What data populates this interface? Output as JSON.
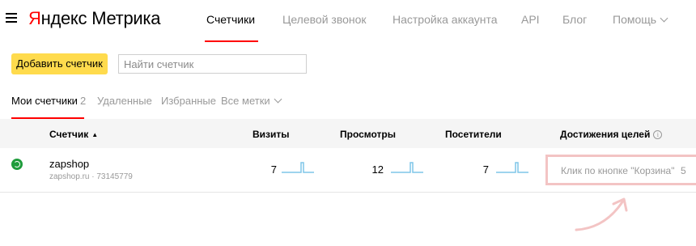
{
  "header": {
    "logo": {
      "ya": "Я",
      "rest": "ндекс",
      "product": "Метрика"
    },
    "nav": [
      {
        "label": "Счетчики",
        "active": true
      },
      {
        "label": "Целевой звонок"
      },
      {
        "label": "Настройка аккаунта"
      },
      {
        "label": "API"
      },
      {
        "label": "Блог"
      },
      {
        "label": "Помощь"
      }
    ]
  },
  "toolbar": {
    "add_button": "Добавить счетчик",
    "search_placeholder": "Найти счетчик"
  },
  "tabs": {
    "mine": "Мои счетчики",
    "mine_count": "2",
    "deleted": "Удаленные",
    "favorites": "Избранные",
    "all_tags": "Все метки"
  },
  "table": {
    "headers": {
      "counter": "Счетчик",
      "visits": "Визиты",
      "views": "Просмотры",
      "visitors": "Посетители",
      "goals": "Достижения целей"
    },
    "rows": [
      {
        "name": "zapshop",
        "subtitle": "zapshop.ru · 73145779",
        "visits": "7",
        "views": "12",
        "visitors": "7",
        "goal_label": "Клик по кнопке \"Корзина\"",
        "goal_value": "5"
      }
    ]
  },
  "colors": {
    "accent_red": "#ff0000",
    "button_yellow": "#ffdb4d",
    "sparkline": "#7fc5e8",
    "status_green": "#1f9c3c",
    "highlight": "#f3c4c4"
  },
  "icons": [
    "hamburger-icon",
    "chevron-down-icon",
    "sort-asc-icon",
    "info-icon",
    "status-active-icon",
    "annotation-arrow"
  ]
}
